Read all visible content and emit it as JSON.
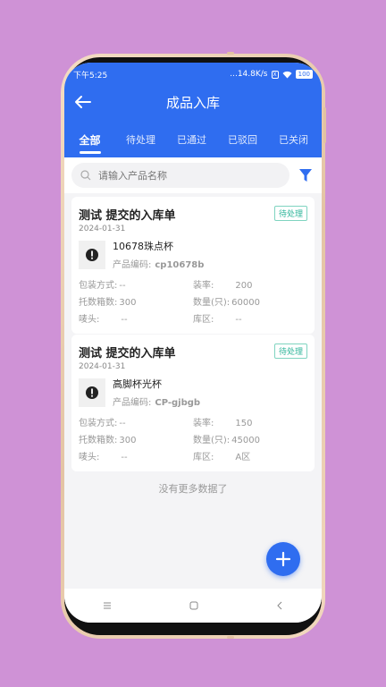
{
  "status": {
    "time": "下午5:25",
    "network": "...14.8K/s",
    "sim": "X",
    "battery": "100"
  },
  "header": {
    "title": "成品入库"
  },
  "tabs": [
    {
      "label": "全部",
      "active": true
    },
    {
      "label": "待处理",
      "active": false
    },
    {
      "label": "已通过",
      "active": false
    },
    {
      "label": "已驳回",
      "active": false
    },
    {
      "label": "已关闭",
      "active": false
    }
  ],
  "search": {
    "placeholder": "请输入产品名称"
  },
  "cards": [
    {
      "title": "测试 提交的入库单",
      "status": "待处理",
      "date": "2024-01-31",
      "product_name": "10678珠点杯",
      "code_label": "产品编码:",
      "code": "cp10678b",
      "fields": [
        {
          "label": "包装方式:",
          "value": "--"
        },
        {
          "label": "装率:",
          "value": "200"
        },
        {
          "label": "托数箱数:",
          "value": "300"
        },
        {
          "label": "数量(只):",
          "value": "60000"
        },
        {
          "label": "唛头:",
          "value": "--"
        },
        {
          "label": "库区:",
          "value": "--"
        }
      ]
    },
    {
      "title": "测试 提交的入库单",
      "status": "待处理",
      "date": "2024-01-31",
      "product_name": "高脚杯光杯",
      "code_label": "产品编码:",
      "code": "CP-gjbgb",
      "fields": [
        {
          "label": "包装方式:",
          "value": "--"
        },
        {
          "label": "装率:",
          "value": "150"
        },
        {
          "label": "托数箱数:",
          "value": "300"
        },
        {
          "label": "数量(只):",
          "value": "45000"
        },
        {
          "label": "唛头:",
          "value": "--"
        },
        {
          "label": "库区:",
          "value": "A区"
        }
      ]
    }
  ],
  "footer": {
    "no_more": "没有更多数据了"
  },
  "colors": {
    "primary": "#2f6df0",
    "badge": "#2fb59a",
    "background": "#cf92d6"
  }
}
